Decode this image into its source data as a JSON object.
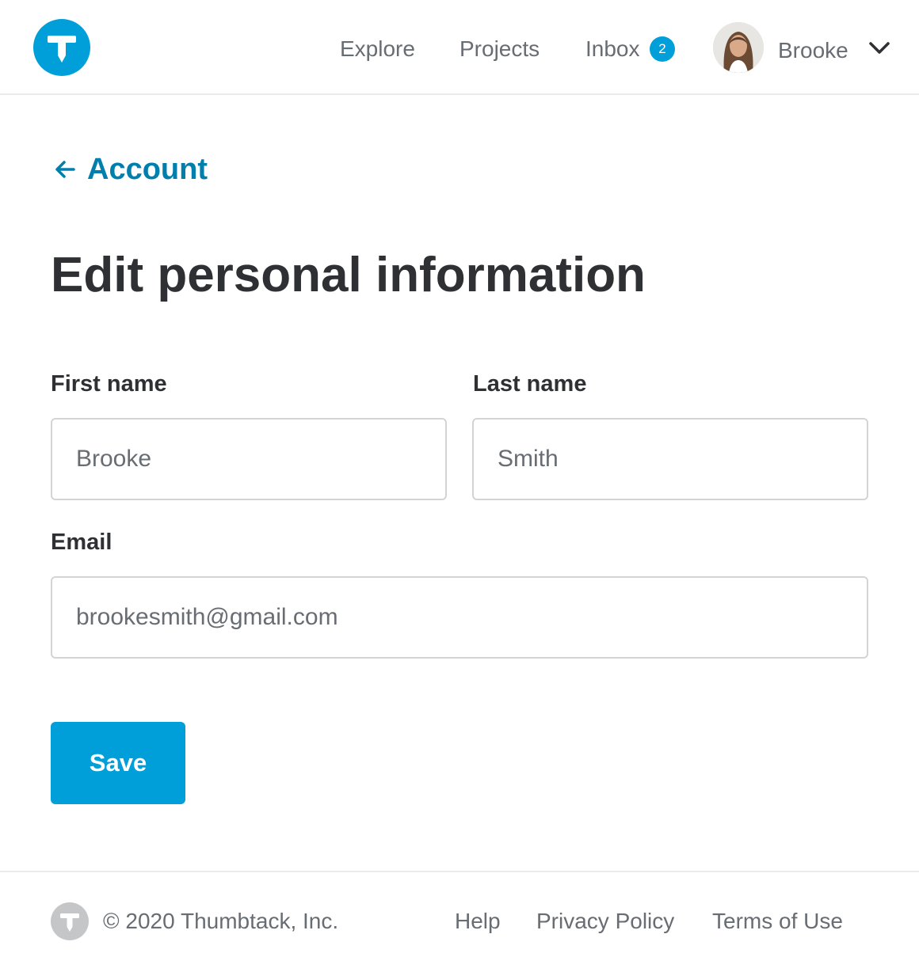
{
  "brand": {
    "logo_icon": "thumbtack-logo-icon",
    "accent_color": "#009fd9",
    "link_color": "#007fad"
  },
  "header": {
    "nav": {
      "explore": "Explore",
      "projects": "Projects",
      "inbox": "Inbox",
      "inbox_count": "2"
    },
    "user": {
      "name": "Brooke",
      "avatar_icon": "user-avatar",
      "menu_icon": "chevron-down-icon"
    }
  },
  "back_link": {
    "label": "Account",
    "icon": "arrow-left-icon"
  },
  "page": {
    "title": "Edit personal information"
  },
  "form": {
    "first_name": {
      "label": "First name",
      "value": "Brooke"
    },
    "last_name": {
      "label": "Last name",
      "value": "Smith"
    },
    "email": {
      "label": "Email",
      "value": "brookesmith@gmail.com"
    },
    "save_label": "Save"
  },
  "footer": {
    "logo_icon": "thumbtack-logo-icon",
    "copyright": "© 2020 Thumbtack, Inc.",
    "links": {
      "help": "Help",
      "privacy": "Privacy Policy",
      "terms": "Terms of Use"
    }
  }
}
